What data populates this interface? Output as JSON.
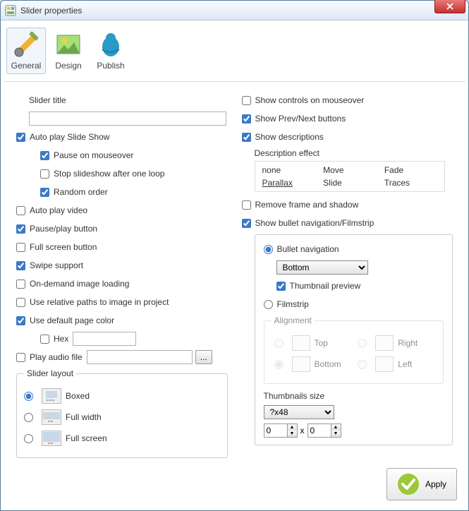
{
  "window": {
    "title": "Slider properties"
  },
  "toolbar": {
    "general": "General",
    "design": "Design",
    "publish": "Publish"
  },
  "left": {
    "slider_title_label": "Slider title",
    "slider_title_value": "",
    "auto_play": "Auto play Slide Show",
    "pause_mouseover": "Pause on mouseover",
    "stop_one_loop": "Stop slideshow after one loop",
    "random_order": "Random order",
    "auto_play_video": "Auto play video",
    "pause_play_button": "Pause/play button",
    "full_screen_button": "Full screen button",
    "swipe_support": "Swipe support",
    "on_demand": "On-demand image loading",
    "relative_paths": "Use relative paths to image in project",
    "default_page_color": "Use default page color",
    "hex_label": "Hex",
    "hex_value": "",
    "play_audio": "Play audio file",
    "audio_value": "",
    "browse": "...",
    "layout_legend": "Slider layout",
    "boxed": "Boxed",
    "full_width": "Full width",
    "full_screen": "Full screen"
  },
  "right": {
    "show_controls": "Show controls on mouseover",
    "show_prevnext": "Show Prev/Next buttons",
    "show_descriptions": "Show descriptions",
    "desc_effect_label": "Description effect",
    "effects": [
      "none",
      "Move",
      "Fade",
      "Parallax",
      "Slide",
      "Traces"
    ],
    "selected_effect": "Parallax",
    "remove_frame": "Remove frame and shadow",
    "show_bullet": "Show bullet navigation/Filmstrip",
    "bullet_nav": "Bullet navigation",
    "bullet_pos": "Bottom",
    "thumb_preview": "Thumbnail preview",
    "filmstrip": "Filmstrip",
    "alignment_legend": "Alignment",
    "align_top": "Top",
    "align_right": "Right",
    "align_bottom": "Bottom",
    "align_left": "Left",
    "thumb_size_label": "Thumbnails size",
    "thumb_size_value": "?x48",
    "size_w": "0",
    "size_x": "x",
    "size_h": "0"
  },
  "footer": {
    "apply": "Apply"
  }
}
